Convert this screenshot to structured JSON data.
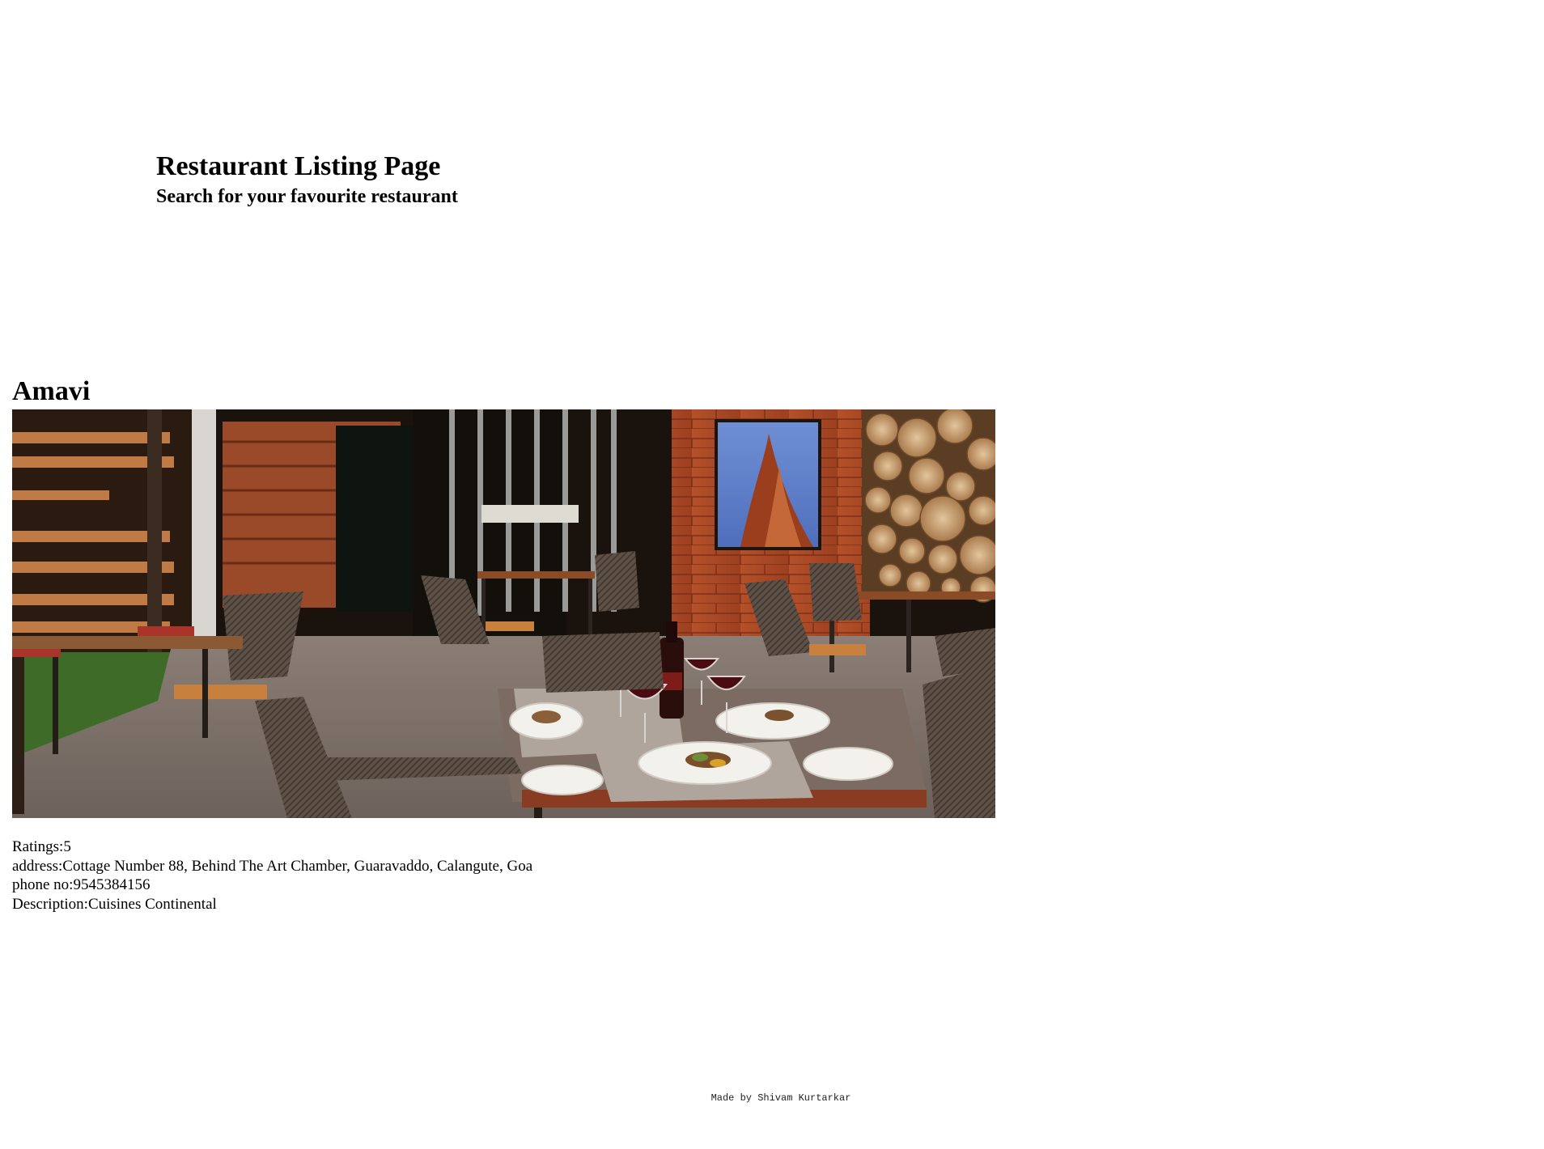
{
  "header": {
    "title": "Restaurant Listing Page",
    "subtitle": "Search for your favourite restaurant"
  },
  "restaurant": {
    "name": "Amavi",
    "image_alt": "Amavi restaurant dining area",
    "ratings_label": "Ratings:",
    "ratings_value": "5",
    "address_label": "address:",
    "address_value": "Cottage Number 88, Behind The Art Chamber, Guaravaddo, Calangute, Goa",
    "phone_label": "phone no:",
    "phone_value": "9545384156",
    "description_label": "Description:",
    "description_value": "Cuisines Continental"
  },
  "footer": {
    "credit": "Made by Shivam Kurtarkar"
  }
}
